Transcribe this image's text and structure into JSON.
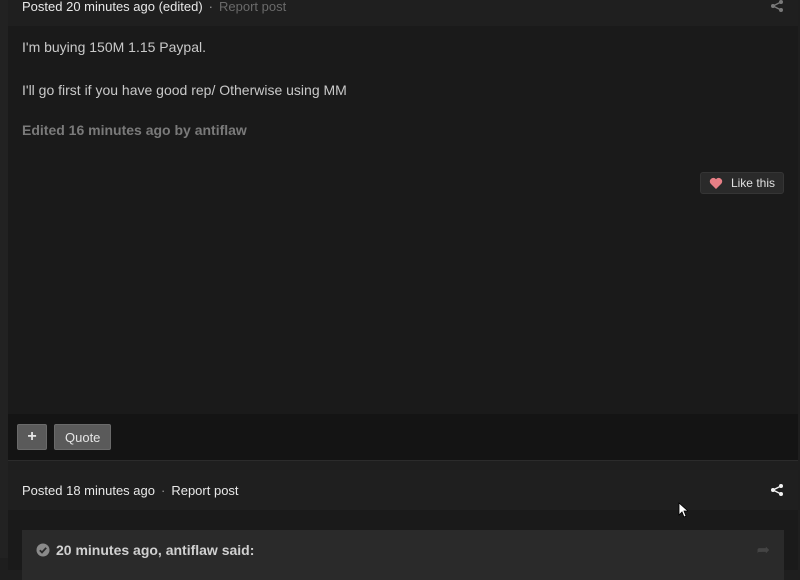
{
  "post1": {
    "posted": "Posted 20 minutes ago (edited)",
    "separator": "·",
    "report": "Report post",
    "body_lines": [
      "I'm buying 150M 1.15 Paypal.",
      "I'll go first if you have good rep/ Otherwise using MM"
    ],
    "edited": "Edited 16 minutes ago by antiflaw",
    "like_label": "Like this",
    "multiquote_label": "+",
    "quote_label": "Quote"
  },
  "post2": {
    "posted": "Posted 18 minutes ago",
    "separator": "·",
    "report": "Report post",
    "quote_header": "20 minutes ago, antiflaw said:"
  },
  "icons": {
    "share": "share-icon",
    "heart": "heart-icon",
    "check": "check-circle-icon",
    "quote_arrow": "arrow-icon"
  },
  "colors": {
    "heart": "#e77f86",
    "background": "#1e1e1e"
  }
}
